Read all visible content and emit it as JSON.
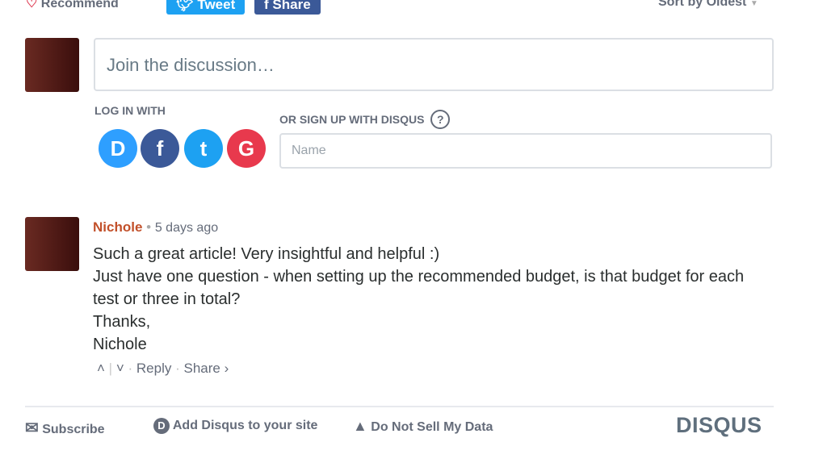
{
  "toolbar": {
    "recommend": "Recommend",
    "tweet": "Tweet",
    "share": "Share",
    "sort": "Sort by Oldest"
  },
  "composer": {
    "placeholder": "Join the discussion…",
    "login_label": "LOG IN WITH",
    "signup_label": "OR SIGN UP WITH DISQUS",
    "name_placeholder": "Name"
  },
  "social": [
    {
      "icon": "D",
      "color": "#2e9fff"
    },
    {
      "icon": "f",
      "color": "#3b5998"
    },
    {
      "icon": "t",
      "color": "#1da1f2"
    },
    {
      "icon": "G",
      "color": "#dd4b39"
    }
  ],
  "comment": {
    "author": "Nichole",
    "author_color": "#c2502a",
    "time": "5 days ago",
    "lines": [
      "Such a great article! Very insightful and helpful :)",
      "Just have one question - when setting up the recommended budget, is that budget for each test or three in total?",
      "Thanks,",
      "Nichole"
    ],
    "reply": "Reply",
    "share": "Share ›"
  },
  "footer": {
    "subscribe": "Subscribe",
    "add": "Add Disqus to your site",
    "dns": "Do Not Sell My Data",
    "logo": "DISQUS"
  }
}
